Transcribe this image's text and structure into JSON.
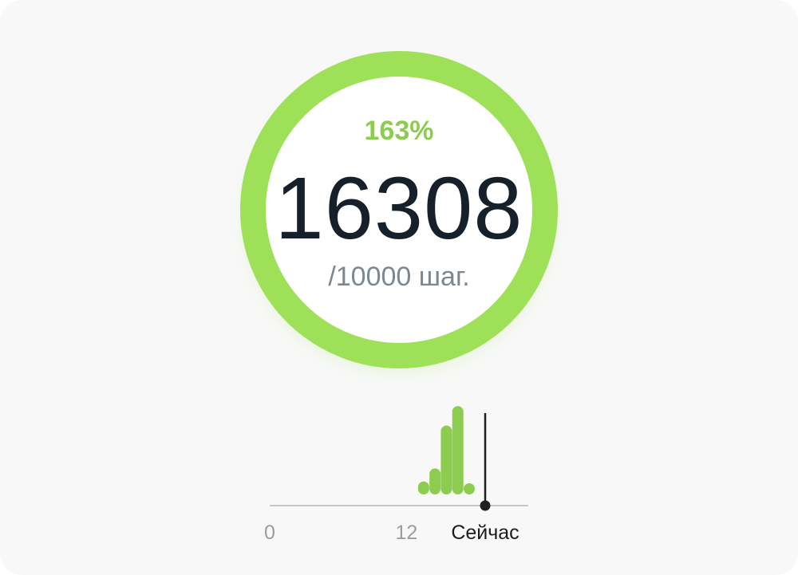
{
  "summary": {
    "percent_label": "163%",
    "steps": "16308",
    "goal_label": "/10000 шаг."
  },
  "colors": {
    "accent": "#9ee058",
    "bar": "#8ccc4e",
    "step_text": "#16202b",
    "muted_text": "#7c8790"
  },
  "progress": {
    "fraction": 1.63
  },
  "chart_data": {
    "type": "bar",
    "x": [
      13.5,
      14.5,
      15.5,
      16.5,
      17.5
    ],
    "values": [
      1,
      2,
      5.3,
      6.8,
      0.8
    ],
    "xlim": [
      0,
      18.9
    ],
    "ylim": [
      0,
      7
    ],
    "now": 18.9,
    "ticks": [
      {
        "value": 0,
        "label": "0"
      },
      {
        "value": 12,
        "label": "12"
      },
      {
        "value": 18.9,
        "label": "Сейчас"
      }
    ]
  }
}
